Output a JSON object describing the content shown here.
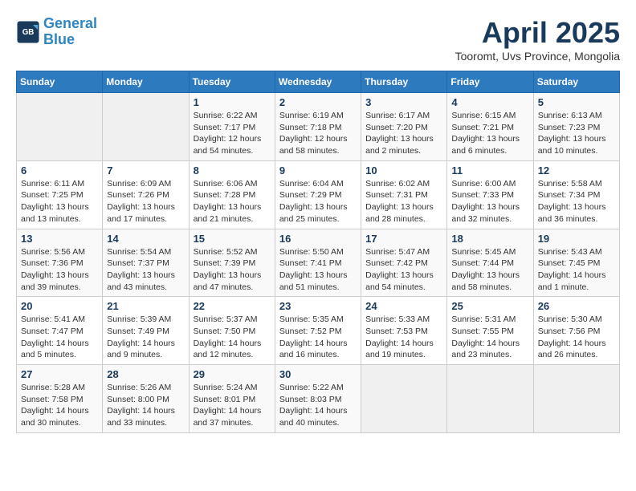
{
  "header": {
    "logo_line1": "General",
    "logo_line2": "Blue",
    "month_title": "April 2025",
    "location": "Tooromt, Uvs Province, Mongolia"
  },
  "weekdays": [
    "Sunday",
    "Monday",
    "Tuesday",
    "Wednesday",
    "Thursday",
    "Friday",
    "Saturday"
  ],
  "weeks": [
    [
      {
        "day": "",
        "info": ""
      },
      {
        "day": "",
        "info": ""
      },
      {
        "day": "1",
        "info": "Sunrise: 6:22 AM\nSunset: 7:17 PM\nDaylight: 12 hours\nand 54 minutes."
      },
      {
        "day": "2",
        "info": "Sunrise: 6:19 AM\nSunset: 7:18 PM\nDaylight: 12 hours\nand 58 minutes."
      },
      {
        "day": "3",
        "info": "Sunrise: 6:17 AM\nSunset: 7:20 PM\nDaylight: 13 hours\nand 2 minutes."
      },
      {
        "day": "4",
        "info": "Sunrise: 6:15 AM\nSunset: 7:21 PM\nDaylight: 13 hours\nand 6 minutes."
      },
      {
        "day": "5",
        "info": "Sunrise: 6:13 AM\nSunset: 7:23 PM\nDaylight: 13 hours\nand 10 minutes."
      }
    ],
    [
      {
        "day": "6",
        "info": "Sunrise: 6:11 AM\nSunset: 7:25 PM\nDaylight: 13 hours\nand 13 minutes."
      },
      {
        "day": "7",
        "info": "Sunrise: 6:09 AM\nSunset: 7:26 PM\nDaylight: 13 hours\nand 17 minutes."
      },
      {
        "day": "8",
        "info": "Sunrise: 6:06 AM\nSunset: 7:28 PM\nDaylight: 13 hours\nand 21 minutes."
      },
      {
        "day": "9",
        "info": "Sunrise: 6:04 AM\nSunset: 7:29 PM\nDaylight: 13 hours\nand 25 minutes."
      },
      {
        "day": "10",
        "info": "Sunrise: 6:02 AM\nSunset: 7:31 PM\nDaylight: 13 hours\nand 28 minutes."
      },
      {
        "day": "11",
        "info": "Sunrise: 6:00 AM\nSunset: 7:33 PM\nDaylight: 13 hours\nand 32 minutes."
      },
      {
        "day": "12",
        "info": "Sunrise: 5:58 AM\nSunset: 7:34 PM\nDaylight: 13 hours\nand 36 minutes."
      }
    ],
    [
      {
        "day": "13",
        "info": "Sunrise: 5:56 AM\nSunset: 7:36 PM\nDaylight: 13 hours\nand 39 minutes."
      },
      {
        "day": "14",
        "info": "Sunrise: 5:54 AM\nSunset: 7:37 PM\nDaylight: 13 hours\nand 43 minutes."
      },
      {
        "day": "15",
        "info": "Sunrise: 5:52 AM\nSunset: 7:39 PM\nDaylight: 13 hours\nand 47 minutes."
      },
      {
        "day": "16",
        "info": "Sunrise: 5:50 AM\nSunset: 7:41 PM\nDaylight: 13 hours\nand 51 minutes."
      },
      {
        "day": "17",
        "info": "Sunrise: 5:47 AM\nSunset: 7:42 PM\nDaylight: 13 hours\nand 54 minutes."
      },
      {
        "day": "18",
        "info": "Sunrise: 5:45 AM\nSunset: 7:44 PM\nDaylight: 13 hours\nand 58 minutes."
      },
      {
        "day": "19",
        "info": "Sunrise: 5:43 AM\nSunset: 7:45 PM\nDaylight: 14 hours\nand 1 minute."
      }
    ],
    [
      {
        "day": "20",
        "info": "Sunrise: 5:41 AM\nSunset: 7:47 PM\nDaylight: 14 hours\nand 5 minutes."
      },
      {
        "day": "21",
        "info": "Sunrise: 5:39 AM\nSunset: 7:49 PM\nDaylight: 14 hours\nand 9 minutes."
      },
      {
        "day": "22",
        "info": "Sunrise: 5:37 AM\nSunset: 7:50 PM\nDaylight: 14 hours\nand 12 minutes."
      },
      {
        "day": "23",
        "info": "Sunrise: 5:35 AM\nSunset: 7:52 PM\nDaylight: 14 hours\nand 16 minutes."
      },
      {
        "day": "24",
        "info": "Sunrise: 5:33 AM\nSunset: 7:53 PM\nDaylight: 14 hours\nand 19 minutes."
      },
      {
        "day": "25",
        "info": "Sunrise: 5:31 AM\nSunset: 7:55 PM\nDaylight: 14 hours\nand 23 minutes."
      },
      {
        "day": "26",
        "info": "Sunrise: 5:30 AM\nSunset: 7:56 PM\nDaylight: 14 hours\nand 26 minutes."
      }
    ],
    [
      {
        "day": "27",
        "info": "Sunrise: 5:28 AM\nSunset: 7:58 PM\nDaylight: 14 hours\nand 30 minutes."
      },
      {
        "day": "28",
        "info": "Sunrise: 5:26 AM\nSunset: 8:00 PM\nDaylight: 14 hours\nand 33 minutes."
      },
      {
        "day": "29",
        "info": "Sunrise: 5:24 AM\nSunset: 8:01 PM\nDaylight: 14 hours\nand 37 minutes."
      },
      {
        "day": "30",
        "info": "Sunrise: 5:22 AM\nSunset: 8:03 PM\nDaylight: 14 hours\nand 40 minutes."
      },
      {
        "day": "",
        "info": ""
      },
      {
        "day": "",
        "info": ""
      },
      {
        "day": "",
        "info": ""
      }
    ]
  ]
}
